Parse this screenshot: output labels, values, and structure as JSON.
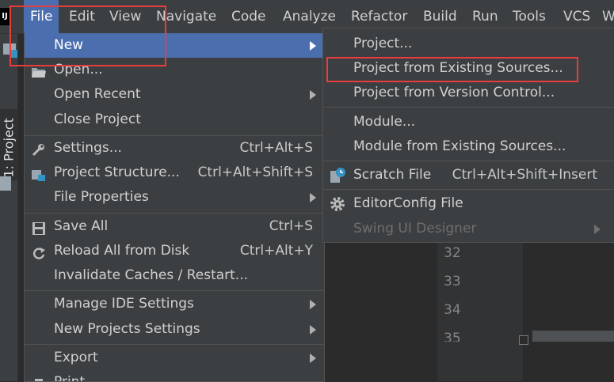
{
  "menubar": {
    "logo": "IJ",
    "items": [
      "File",
      "Edit",
      "View",
      "Navigate",
      "Code",
      "Analyze",
      "Refactor",
      "Build",
      "Run",
      "Tools",
      "VCS",
      "W"
    ]
  },
  "toolwindow": {
    "project_tab": "1: Project"
  },
  "editor": {
    "line_numbers": [
      "32",
      "33",
      "34",
      "35"
    ]
  },
  "file_menu": {
    "items": [
      {
        "label": "New",
        "shortcut": "",
        "submenu": true,
        "selected": true,
        "icon": ""
      },
      {
        "label": "Open...",
        "shortcut": "",
        "submenu": false,
        "icon": "folder-icon"
      },
      {
        "label": "Open Recent",
        "shortcut": "",
        "submenu": true,
        "icon": ""
      },
      {
        "label": "Close Project",
        "shortcut": "",
        "submenu": false,
        "icon": ""
      },
      {
        "label": "Settings...",
        "shortcut": "Ctrl+Alt+S",
        "submenu": false,
        "icon": "wrench-icon"
      },
      {
        "label": "Project Structure...",
        "shortcut": "Ctrl+Alt+Shift+S",
        "submenu": false,
        "icon": "project-structure-icon"
      },
      {
        "label": "File Properties",
        "shortcut": "",
        "submenu": true,
        "icon": ""
      },
      {
        "label": "Save All",
        "shortcut": "Ctrl+S",
        "submenu": false,
        "icon": "save-icon"
      },
      {
        "label": "Reload All from Disk",
        "shortcut": "Ctrl+Alt+Y",
        "submenu": false,
        "icon": "reload-icon"
      },
      {
        "label": "Invalidate Caches / Restart...",
        "shortcut": "",
        "submenu": false,
        "icon": ""
      },
      {
        "label": "Manage IDE Settings",
        "shortcut": "",
        "submenu": true,
        "icon": ""
      },
      {
        "label": "New Projects Settings",
        "shortcut": "",
        "submenu": true,
        "icon": ""
      },
      {
        "label": "Export",
        "shortcut": "",
        "submenu": true,
        "icon": ""
      },
      {
        "label": "Print...",
        "shortcut": "",
        "submenu": false,
        "icon": "print-icon"
      }
    ]
  },
  "new_submenu": {
    "items": [
      {
        "label": "Project...",
        "shortcut": ""
      },
      {
        "label": "Project from Existing Sources...",
        "shortcut": ""
      },
      {
        "label": "Project from Version Control...",
        "shortcut": ""
      },
      {
        "label": "Module...",
        "shortcut": ""
      },
      {
        "label": "Module from Existing Sources...",
        "shortcut": ""
      },
      {
        "label": "Scratch File",
        "shortcut": "Ctrl+Alt+Shift+Insert",
        "icon": "scratch-file-icon"
      },
      {
        "label": "EditorConfig File",
        "shortcut": "",
        "icon": "gear-icon"
      },
      {
        "label": "Swing UI Designer",
        "shortcut": "",
        "disabled": true,
        "submenu": true
      }
    ]
  },
  "colors": {
    "selection": "#4b6eaf",
    "highlight_box": "#e83d3d",
    "menu_bg": "#3c3f41"
  }
}
